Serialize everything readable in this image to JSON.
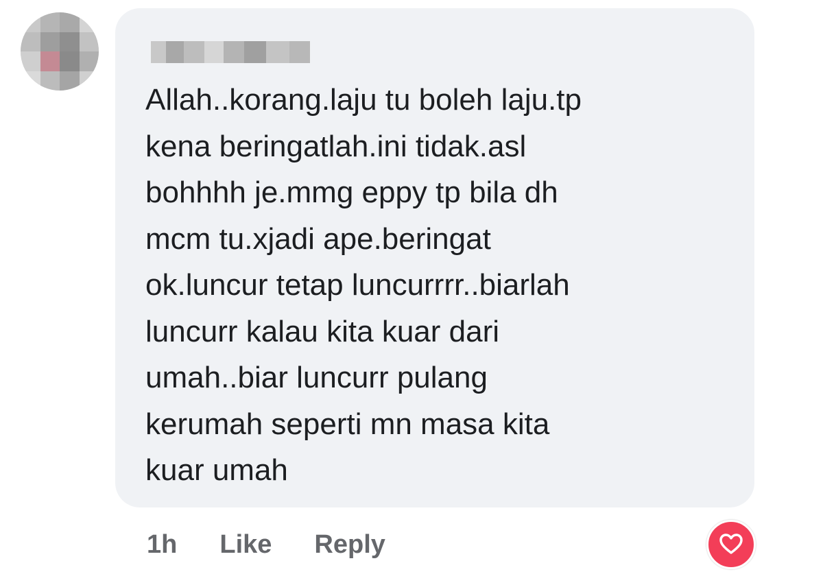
{
  "comment": {
    "author_name": "",
    "text": "Allah..korang.laju tu boleh laju.tp\nkena beringatlah.ini tidak.asl\nbohhhh je.mmg eppy tp bila dh\nmcm tu.xjadi ape.beringat\nok.luncur tetap luncurrrr..biarlah\nluncurr kalau kita kuar dari\numah..biar luncurr pulang\nkerumah seperti mn masa kita\nkuar umah",
    "timestamp": "1h",
    "like_label": "Like",
    "reply_label": "Reply",
    "reaction_icon": "heart-icon"
  },
  "colors": {
    "bubble_background": "#f0f2f5",
    "text": "#1c1e21",
    "action_text": "#65676b",
    "love_reaction": "#f33e58"
  }
}
